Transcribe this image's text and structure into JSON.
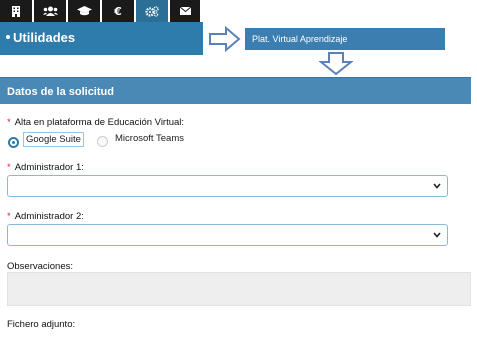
{
  "tabs": [
    {
      "icon": "building-icon"
    },
    {
      "icon": "users-icon"
    },
    {
      "icon": "graduation-cap-icon"
    },
    {
      "icon": "euro-icon",
      "glyph": "€"
    },
    {
      "icon": "cogs-icon"
    },
    {
      "icon": "envelope-icon"
    }
  ],
  "colors": {
    "accent": "#2d7cac",
    "section": "#4a88b6",
    "required": "#dd2233"
  },
  "header": {
    "title": "Utilidades"
  },
  "annotation": {
    "box_label": "Plat. Virtual Aprendizaje"
  },
  "form": {
    "section_title": "Datos de la solicitud",
    "platform": {
      "label": "Alta en plataforma de Educación Virtual:",
      "options": [
        {
          "label": "Google Suite",
          "selected": true
        },
        {
          "label": "Microsoft Teams",
          "selected": false
        }
      ]
    },
    "admin1": {
      "label": "Administrador 1:",
      "value": ""
    },
    "admin2": {
      "label": "Administrador 2:",
      "value": ""
    },
    "observaciones": {
      "label": "Observaciones:",
      "value": ""
    },
    "fichero": {
      "label": "Fichero adjunto:"
    }
  }
}
